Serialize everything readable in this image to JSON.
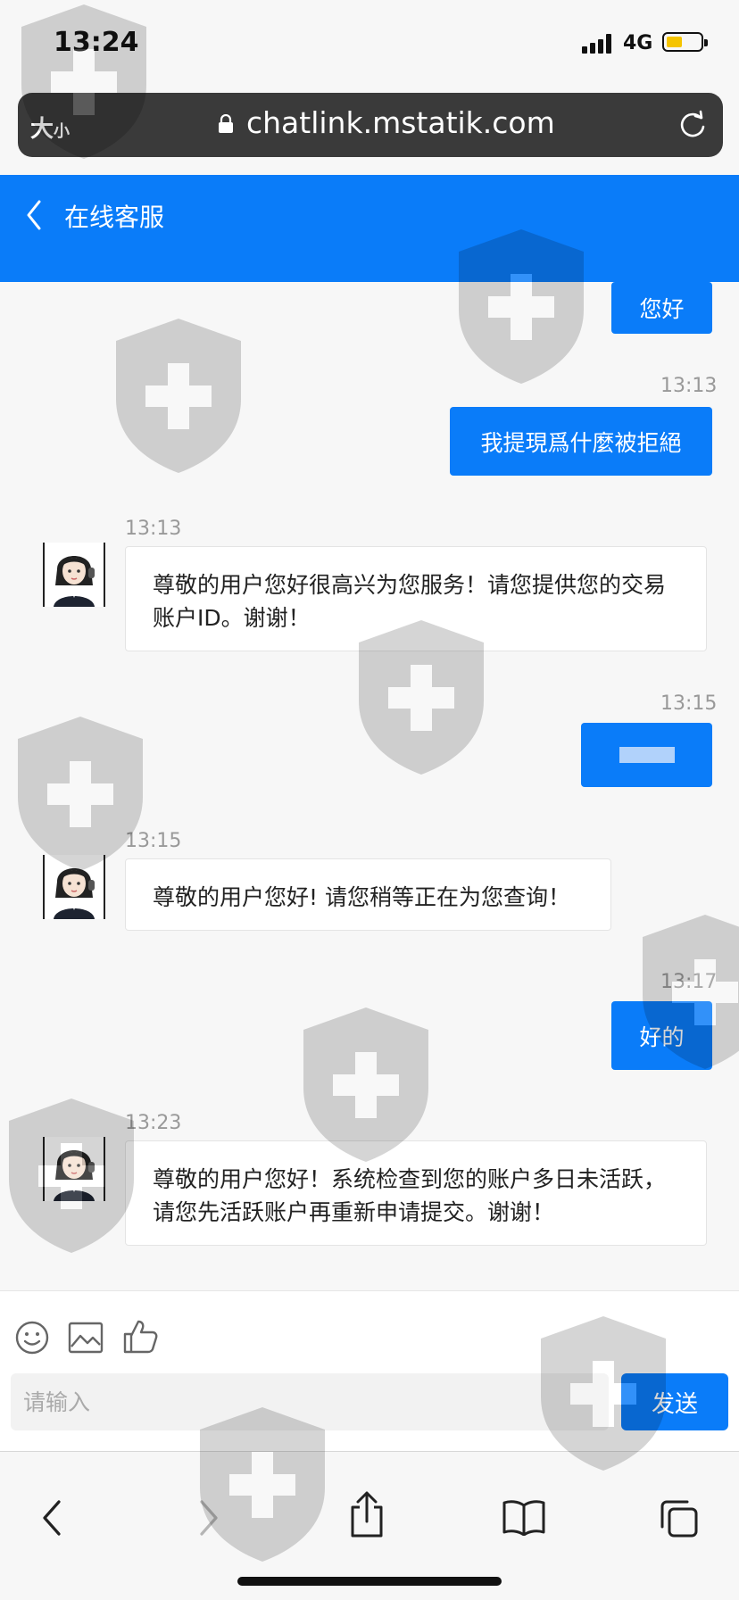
{
  "status_bar": {
    "time": "13:24",
    "network": "4G",
    "battery_level": 0.45,
    "signal_bars": 4
  },
  "browser": {
    "text_size_label": "大",
    "text_size_small": "小",
    "url": "chatlink.mstatik.com"
  },
  "header": {
    "title": "在线客服"
  },
  "messages": [
    {
      "from": "user",
      "time": "",
      "text": "您好"
    },
    {
      "from": "user",
      "time": "13:13",
      "text": "我提現爲什麼被拒絕"
    },
    {
      "from": "agent",
      "time": "13:13",
      "text": "尊敬的用户您好很高兴为您服务！请您提供您的交易账户ID。谢谢！"
    },
    {
      "from": "user",
      "time": "13:15",
      "text": ""
    },
    {
      "from": "agent",
      "time": "13:15",
      "text": "尊敬的用户您好! 请您稍等正在为您查询！"
    },
    {
      "from": "user",
      "time": "13:17",
      "text": "好的"
    },
    {
      "from": "agent",
      "time": "13:23",
      "text": "尊敬的用户您好！系统检查到您的账户多日未活跃，请您先活跃账户再重新申请提交。谢谢！"
    }
  ],
  "composer": {
    "placeholder": "请输入",
    "send_label": "发送",
    "tools": [
      "smiley-icon",
      "image-icon",
      "thumbs-up-icon"
    ]
  },
  "toolbar": {
    "icons": [
      "back-icon",
      "forward-icon",
      "share-icon",
      "bookmarks-icon",
      "tabs-icon"
    ]
  },
  "colors": {
    "accent": "#0a7cf9",
    "url_bar": "#3a3a3a",
    "battery": "#f5c400"
  }
}
